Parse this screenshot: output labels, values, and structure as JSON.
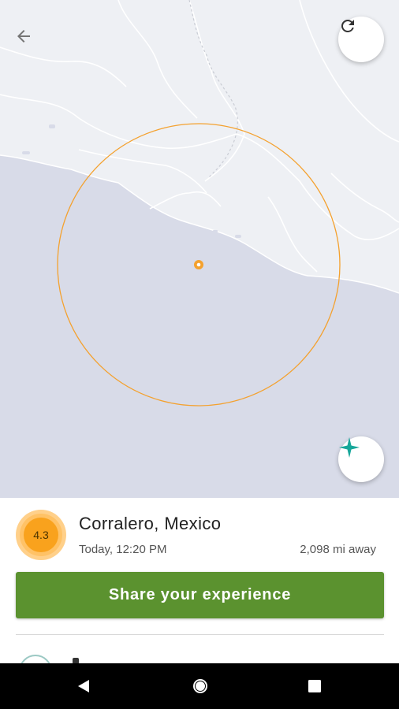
{
  "map": {
    "icons": {
      "back": "arrow-back-icon",
      "refresh": "refresh-icon",
      "compass": "compass-icon"
    },
    "colors": {
      "land": "#eef0f4",
      "water": "#d8dbe8",
      "radius_circle": "#f4a12e",
      "epicenter": "#f4a12e"
    }
  },
  "event": {
    "magnitude": "4.3",
    "location": "Corralero, Mexico",
    "time": "Today, 12:20 PM",
    "distance": "2,098 mi away"
  },
  "actions": {
    "share_label": "Share your experience",
    "share_color": "#5b922f"
  },
  "system_nav": {
    "back": "nav-back-triangle-icon",
    "home": "nav-home-circle-icon",
    "recents": "nav-recents-square-icon"
  }
}
